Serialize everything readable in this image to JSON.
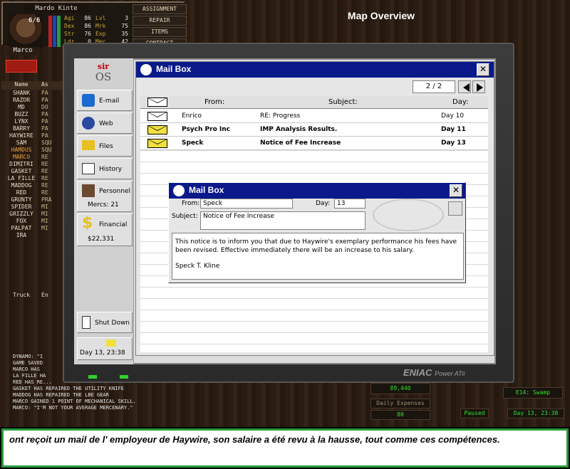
{
  "merc": {
    "name": "Mardo Kinte",
    "short": "Marco",
    "hp": "6/6",
    "stats": [
      {
        "k": "Agi",
        "v": "86",
        "k2": "Lvl",
        "v2": "3"
      },
      {
        "k": "Dex",
        "v": "86",
        "k2": "Mrk",
        "v2": "75"
      },
      {
        "k": "Str",
        "v": "76",
        "k2": "Exp",
        "v2": "35"
      },
      {
        "k": "Ldr",
        "v": "0",
        "k2": "Mec",
        "v2": "42"
      }
    ],
    "actions": [
      "Assignment",
      "Repair",
      "Items",
      "Contract"
    ]
  },
  "roster": {
    "headers": [
      "Name",
      "As"
    ],
    "rows": [
      {
        "name": "Shank",
        "assign": "Pa"
      },
      {
        "name": "Razor",
        "assign": "Pa"
      },
      {
        "name": "MD",
        "assign": "Do"
      },
      {
        "name": "Buzz",
        "assign": "Pa"
      },
      {
        "name": "Lynx",
        "assign": "Pa"
      },
      {
        "name": "Barry",
        "assign": "Pa"
      },
      {
        "name": "Haywire",
        "assign": "Pa"
      },
      {
        "name": "Sam",
        "assign": "Squ"
      },
      {
        "name": "Hamous",
        "assign": "Squ"
      },
      {
        "name": "Marco",
        "assign": "Re"
      },
      {
        "name": "Dimitri",
        "assign": "Re"
      },
      {
        "name": "Gasket",
        "assign": "Re"
      },
      {
        "name": "La Fille",
        "assign": "Re"
      },
      {
        "name": "Maddog",
        "assign": "Re"
      },
      {
        "name": "Red",
        "assign": "Re"
      },
      {
        "name": "Grunty",
        "assign": "Pra"
      },
      {
        "name": "Spider",
        "assign": "Mi"
      },
      {
        "name": "Grizzly",
        "assign": "Mi"
      },
      {
        "name": "Fox",
        "assign": "Mi"
      },
      {
        "name": "Palpat",
        "assign": "Mi"
      },
      {
        "name": "Ira",
        "assign": ""
      }
    ],
    "truck": "Truck",
    "truck_assign": "En"
  },
  "map_title": "Map Overview",
  "log": [
    "Dynamo: \"I",
    "Game saved",
    "Marco has",
    "La Fille ha",
    "Red has re...",
    "Gasket has repaired the utility knife",
    "Maddog has repaired the LBE gear",
    "Marco gained 1 point of mechanical skill.",
    "Marco: \"I'm not your average mercenary.\""
  ],
  "bottom_right": {
    "balance": "89,440",
    "daily_label": "Daily Expenses",
    "daily_value": "80",
    "sector": "E14: Swamp",
    "paused": "Paused",
    "game_time": "Day 13, 23:38"
  },
  "laptop": {
    "os_top": "sir",
    "os_bottom": "OS",
    "sidebar": [
      {
        "label": "E-mail"
      },
      {
        "label": "Web"
      },
      {
        "label": "Files"
      },
      {
        "label": "History"
      },
      {
        "label": "Personnel",
        "sub": "Mercs: 21"
      },
      {
        "label": "Financial",
        "sub": "$22,331"
      }
    ],
    "shutdown": "Shut Down",
    "clock": "Day 13, 23:38",
    "brand": "ENIAC",
    "model": "Power ATii"
  },
  "mailbox": {
    "title": "Mail Box",
    "page": "2 / 2",
    "columns": {
      "from": "From:",
      "subject": "Subject:",
      "day": "Day:"
    },
    "rows": [
      {
        "from": "Enrico",
        "subject": "RE: Progress",
        "day": "Day 10",
        "unread": false
      },
      {
        "from": "Psych Pro Inc",
        "subject": "IMP Analysis Results.",
        "day": "Day 11",
        "unread": true
      },
      {
        "from": "Speck",
        "subject": "Notice of Fee Increase",
        "day": "Day 13",
        "unread": true
      }
    ]
  },
  "message": {
    "title": "Mail Box",
    "from_label": "From:",
    "from": "Speck",
    "day_label": "Day:",
    "day": "13",
    "subject_label": "Subject:",
    "subject": "Notice of Fee Increase",
    "body": "This notice is to inform you that due to Haywire's exemplary performance his fees have been revised. Effective immediately there will be an increase to his salary.",
    "signature": "Speck T. Kline"
  },
  "caption": "ont reçoit un mail de l' employeur de Haywire, son salaire a été revu à la hausse, tout comme ces compétences."
}
